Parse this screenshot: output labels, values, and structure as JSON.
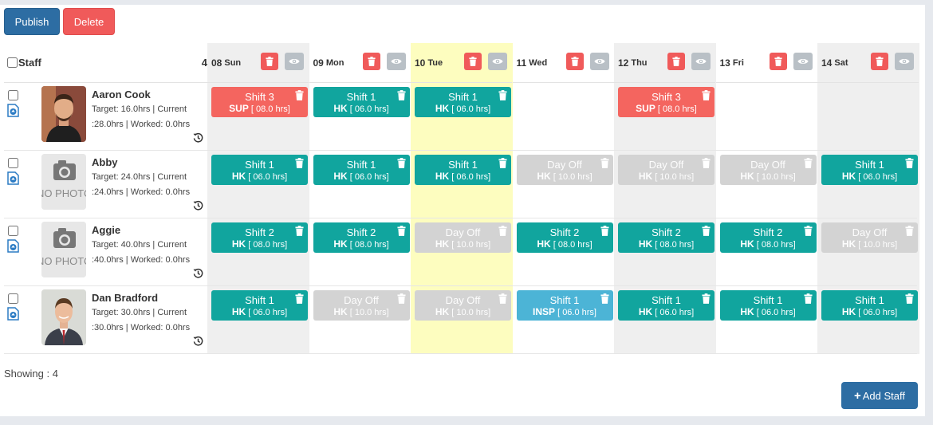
{
  "toolbar": {
    "publish_label": "Publish",
    "delete_label": "Delete"
  },
  "header": {
    "staff_label": "Staff",
    "staff_count": "4"
  },
  "days": [
    {
      "num": "08",
      "name": "Sun",
      "bg": "#efefef"
    },
    {
      "num": "09",
      "name": "Mon",
      "bg": "#ffffff"
    },
    {
      "num": "10",
      "name": "Tue",
      "bg": "#fdfdbf"
    },
    {
      "num": "11",
      "name": "Wed",
      "bg": "#ffffff"
    },
    {
      "num": "12",
      "name": "Thu",
      "bg": "#efefef"
    },
    {
      "num": "13",
      "name": "Fri",
      "bg": "#ffffff"
    },
    {
      "num": "14",
      "name": "Sat",
      "bg": "#efefef"
    }
  ],
  "staff": [
    {
      "name": "Aaron Cook",
      "info1": "Target: 16.0hrs | Current",
      "info2": ":28.0hrs | Worked: 0.0hrs",
      "photo": "person-photo-1",
      "shifts": [
        {
          "label": "Shift 3",
          "code": "SUP",
          "hours": "[ 08.0 hrs]",
          "color": "red"
        },
        {
          "label": "Shift 1",
          "code": "HK",
          "hours": "[ 06.0 hrs]",
          "color": "teal"
        },
        {
          "label": "Shift 1",
          "code": "HK",
          "hours": "[ 06.0 hrs]",
          "color": "teal"
        },
        null,
        {
          "label": "Shift 3",
          "code": "SUP",
          "hours": "[ 08.0 hrs]",
          "color": "red"
        },
        null,
        null
      ]
    },
    {
      "name": "Abby",
      "info1": "Target: 24.0hrs | Current",
      "info2": ":24.0hrs | Worked: 0.0hrs",
      "photo": "no-photo",
      "nophoto_text": "NO PHOTO",
      "shifts": [
        {
          "label": "Shift 1",
          "code": "HK",
          "hours": "[ 06.0 hrs]",
          "color": "teal"
        },
        {
          "label": "Shift 1",
          "code": "HK",
          "hours": "[ 06.0 hrs]",
          "color": "teal"
        },
        {
          "label": "Shift 1",
          "code": "HK",
          "hours": "[ 06.0 hrs]",
          "color": "teal"
        },
        {
          "label": "Day Off",
          "code": "HK",
          "hours": "[ 10.0 hrs]",
          "color": "grey"
        },
        {
          "label": "Day Off",
          "code": "HK",
          "hours": "[ 10.0 hrs]",
          "color": "grey"
        },
        {
          "label": "Day Off",
          "code": "HK",
          "hours": "[ 10.0 hrs]",
          "color": "grey"
        },
        {
          "label": "Shift 1",
          "code": "HK",
          "hours": "[ 06.0 hrs]",
          "color": "teal"
        }
      ]
    },
    {
      "name": "Aggie",
      "info1": "Target: 40.0hrs | Current",
      "info2": ":40.0hrs | Worked: 0.0hrs",
      "photo": "no-photo",
      "nophoto_text": "NO PHOTO",
      "shifts": [
        {
          "label": "Shift 2",
          "code": "HK",
          "hours": "[ 08.0 hrs]",
          "color": "teal"
        },
        {
          "label": "Shift 2",
          "code": "HK",
          "hours": "[ 08.0 hrs]",
          "color": "teal"
        },
        {
          "label": "Day Off",
          "code": "HK",
          "hours": "[ 10.0 hrs]",
          "color": "grey"
        },
        {
          "label": "Shift 2",
          "code": "HK",
          "hours": "[ 08.0 hrs]",
          "color": "teal"
        },
        {
          "label": "Shift 2",
          "code": "HK",
          "hours": "[ 08.0 hrs]",
          "color": "teal"
        },
        {
          "label": "Shift 2",
          "code": "HK",
          "hours": "[ 08.0 hrs]",
          "color": "teal"
        },
        {
          "label": "Day Off",
          "code": "HK",
          "hours": "[ 10.0 hrs]",
          "color": "grey"
        }
      ]
    },
    {
      "name": "Dan Bradford",
      "info1": "Target: 30.0hrs | Current",
      "info2": ":30.0hrs | Worked: 0.0hrs",
      "photo": "person-photo-2",
      "shifts": [
        {
          "label": "Shift 1",
          "code": "HK",
          "hours": "[ 06.0 hrs]",
          "color": "teal"
        },
        {
          "label": "Day Off",
          "code": "HK",
          "hours": "[ 10.0 hrs]",
          "color": "grey"
        },
        {
          "label": "Day Off",
          "code": "HK",
          "hours": "[ 10.0 hrs]",
          "color": "grey"
        },
        {
          "label": "Shift 1",
          "code": "INSP",
          "hours": "[ 06.0 hrs]",
          "color": "blue"
        },
        {
          "label": "Shift 1",
          "code": "HK",
          "hours": "[ 06.0 hrs]",
          "color": "teal"
        },
        {
          "label": "Shift 1",
          "code": "HK",
          "hours": "[ 06.0 hrs]",
          "color": "teal"
        },
        {
          "label": "Shift 1",
          "code": "HK",
          "hours": "[ 06.0 hrs]",
          "color": "teal"
        }
      ]
    }
  ],
  "footer": {
    "showing": "Showing : 4",
    "add_staff_label": "Add Staff",
    "add_icon": "+"
  },
  "colors": {
    "primary": "#2d6da3",
    "danger": "#f05a5a",
    "teal": "#11a59e",
    "grey": "#d3d3d3",
    "blue": "#4cb4d6",
    "today": "#fdfdbf"
  }
}
